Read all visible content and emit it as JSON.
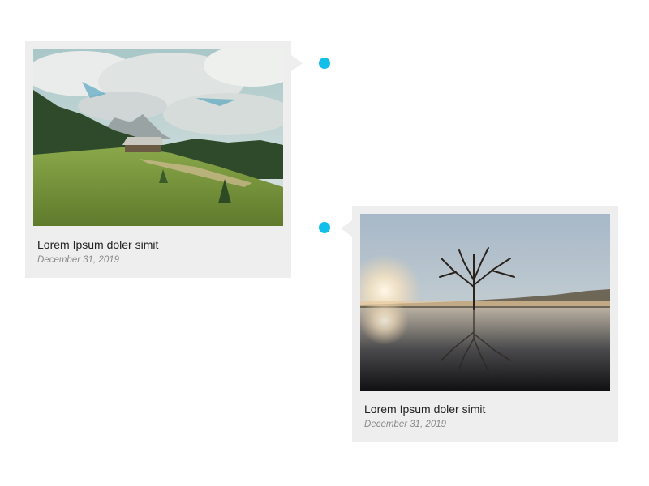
{
  "accent_color": "#12bfe9",
  "timeline": {
    "items": [
      {
        "title": "Lorem Ipsum doler simit",
        "date": "December 31, 2019",
        "image": "mountain-meadow-cabin-photo",
        "side": "left"
      },
      {
        "title": "Lorem Ipsum doler simit",
        "date": "December 31, 2019",
        "image": "lone-tree-lake-sunrise-photo",
        "side": "right"
      }
    ]
  }
}
